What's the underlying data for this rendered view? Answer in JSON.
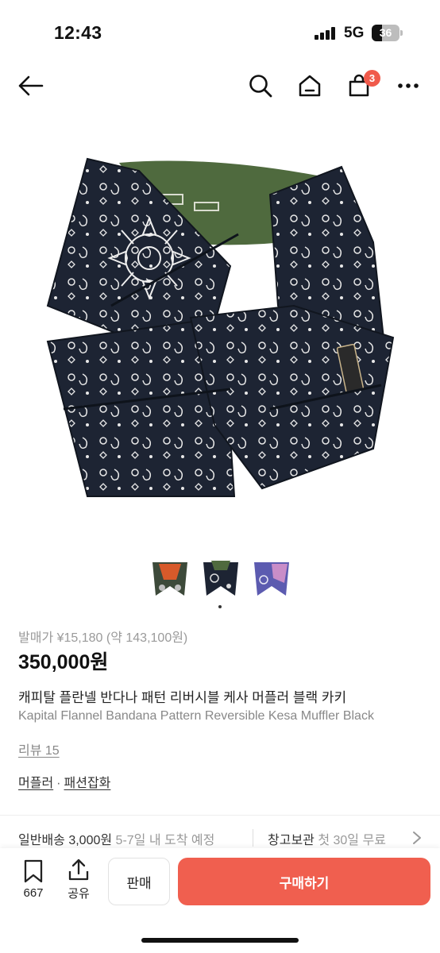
{
  "status_bar": {
    "time": "12:43",
    "network": "5G",
    "battery": "36"
  },
  "nav": {
    "cart_count": "3",
    "icons": [
      "back-arrow-icon",
      "search-icon",
      "home-icon",
      "shopping-bag-icon",
      "more-icon"
    ]
  },
  "product": {
    "original_price": "발매가 ¥15,180 (약 143,100원)",
    "price": "350,000원",
    "title_ko": "캐피탈 플란넬 반다나 패턴 리버시블 케사 머플러 블랙 카키",
    "title_en": "Kapital Flannel Bandana Pattern Reversible Kesa Muffler Black",
    "reviews": "리뷰 15",
    "category": [
      "머플러",
      "패션잡화"
    ],
    "category_separator": "·"
  },
  "gallery": {
    "thumbnails": [
      "thumbnail-orange",
      "thumbnail-navy",
      "thumbnail-purple"
    ],
    "selected_index": 1
  },
  "delivery": {
    "shipping_label": "일반배송 3,000원",
    "shipping_eta": "5-7일 내 도착 예정",
    "storage_label": "창고보관",
    "storage_note": "첫 30일 무료"
  },
  "bottom_bar": {
    "bookmark_count": "667",
    "share_label": "공유",
    "sell_label": "판매",
    "buy_label": "구매하기"
  },
  "colors": {
    "accent": "#f05f4f",
    "badge": "#f05a4b",
    "scarf_dark": "#1d2433",
    "scarf_khaki": "#4f6a3e"
  }
}
